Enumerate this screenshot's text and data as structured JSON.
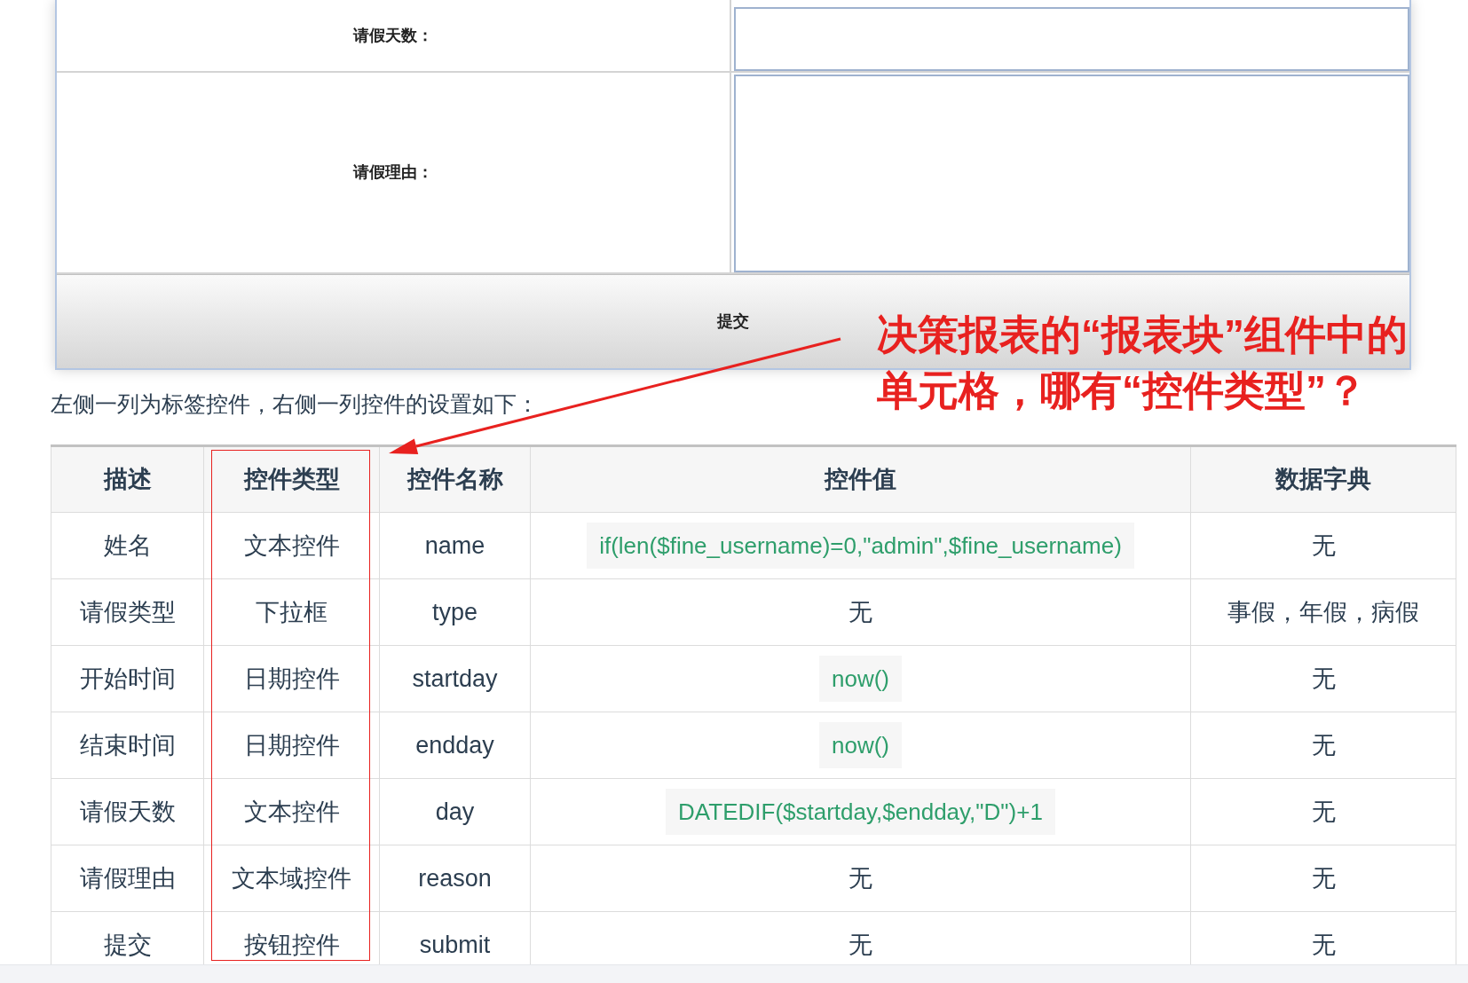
{
  "form_preview": {
    "rows": [
      {
        "label": "请假天数：",
        "kind": "input"
      },
      {
        "label": "请假理由：",
        "kind": "textarea"
      }
    ],
    "submit_button": "提交"
  },
  "intro": "左侧一列为标签控件，右侧一列控件的设置如下：",
  "table": {
    "columns": [
      {
        "label": "描述",
        "highlighted": false
      },
      {
        "label": "控件类型",
        "highlighted": true
      },
      {
        "label": "控件名称",
        "highlighted": false
      },
      {
        "label": "控件值",
        "highlighted": false
      },
      {
        "label": "数据字典",
        "highlighted": false
      }
    ],
    "rows": [
      {
        "cells": [
          {
            "text": "姓名",
            "kind": "text"
          },
          {
            "text": "文本控件",
            "kind": "text"
          },
          {
            "text": "name",
            "kind": "text"
          },
          {
            "text": "if(len($fine_username)=0,\"admin\",$fine_username)",
            "kind": "code"
          },
          {
            "text": "无",
            "kind": "text"
          }
        ]
      },
      {
        "cells": [
          {
            "text": "请假类型",
            "kind": "text"
          },
          {
            "text": "下拉框",
            "kind": "text"
          },
          {
            "text": "type",
            "kind": "text"
          },
          {
            "text": "无",
            "kind": "text"
          },
          {
            "text": "事假，年假，病假",
            "kind": "text"
          }
        ]
      },
      {
        "cells": [
          {
            "text": "开始时间",
            "kind": "text"
          },
          {
            "text": "日期控件",
            "kind": "text"
          },
          {
            "text": "startday",
            "kind": "text"
          },
          {
            "text": "now()",
            "kind": "code"
          },
          {
            "text": "无",
            "kind": "text"
          }
        ]
      },
      {
        "cells": [
          {
            "text": "结束时间",
            "kind": "text"
          },
          {
            "text": "日期控件",
            "kind": "text"
          },
          {
            "text": "endday",
            "kind": "text"
          },
          {
            "text": "now()",
            "kind": "code"
          },
          {
            "text": "无",
            "kind": "text"
          }
        ]
      },
      {
        "cells": [
          {
            "text": "请假天数",
            "kind": "text"
          },
          {
            "text": "文本控件",
            "kind": "text"
          },
          {
            "text": "day",
            "kind": "text"
          },
          {
            "text": "DATEDIF($startday,$endday,\"D\")+1",
            "kind": "code"
          },
          {
            "text": "无",
            "kind": "text"
          }
        ]
      },
      {
        "cells": [
          {
            "text": "请假理由",
            "kind": "text"
          },
          {
            "text": "文本域控件",
            "kind": "text"
          },
          {
            "text": "reason",
            "kind": "text"
          },
          {
            "text": "无",
            "kind": "text"
          },
          {
            "text": "无",
            "kind": "text"
          }
        ]
      },
      {
        "cells": [
          {
            "text": "提交",
            "kind": "text"
          },
          {
            "text": "按钮控件",
            "kind": "text"
          },
          {
            "text": "submit",
            "kind": "text"
          },
          {
            "text": "无",
            "kind": "text"
          },
          {
            "text": "无",
            "kind": "text"
          }
        ]
      }
    ]
  },
  "annotation": {
    "lines": [
      "决策报表的“报表块”组件中的",
      "单元格，哪有“控件类型”？"
    ]
  }
}
